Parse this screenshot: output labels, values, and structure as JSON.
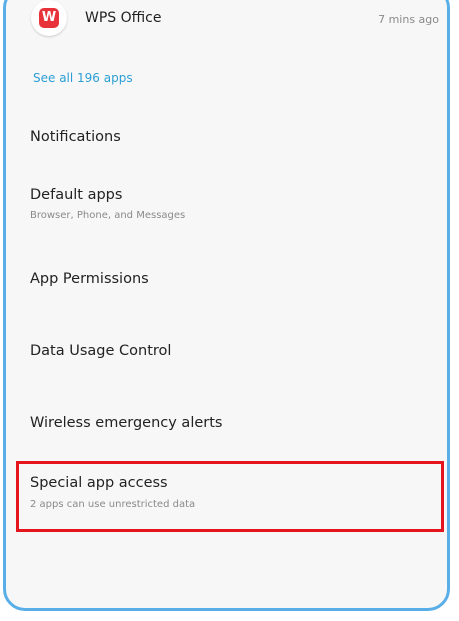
{
  "app": {
    "name": "WPS Office",
    "time": "7 mins ago",
    "icon": "wps-office-icon",
    "icon_glyph": "W"
  },
  "see_all": "See all 196 apps",
  "items": [
    {
      "title": "Notifications",
      "subtitle": ""
    },
    {
      "title": "Default apps",
      "subtitle": "Browser, Phone, and Messages"
    },
    {
      "title": "App Permissions",
      "subtitle": ""
    },
    {
      "title": "Data Usage Control",
      "subtitle": ""
    },
    {
      "title": "Wireless emergency alerts",
      "subtitle": ""
    },
    {
      "title": "Special app access",
      "subtitle": "2 apps can use unrestricted data"
    }
  ],
  "colors": {
    "accent": "#2b9fd6",
    "frame_border": "#5aaee8",
    "highlight": "#e5151e",
    "wps_red": "#e8323a"
  }
}
